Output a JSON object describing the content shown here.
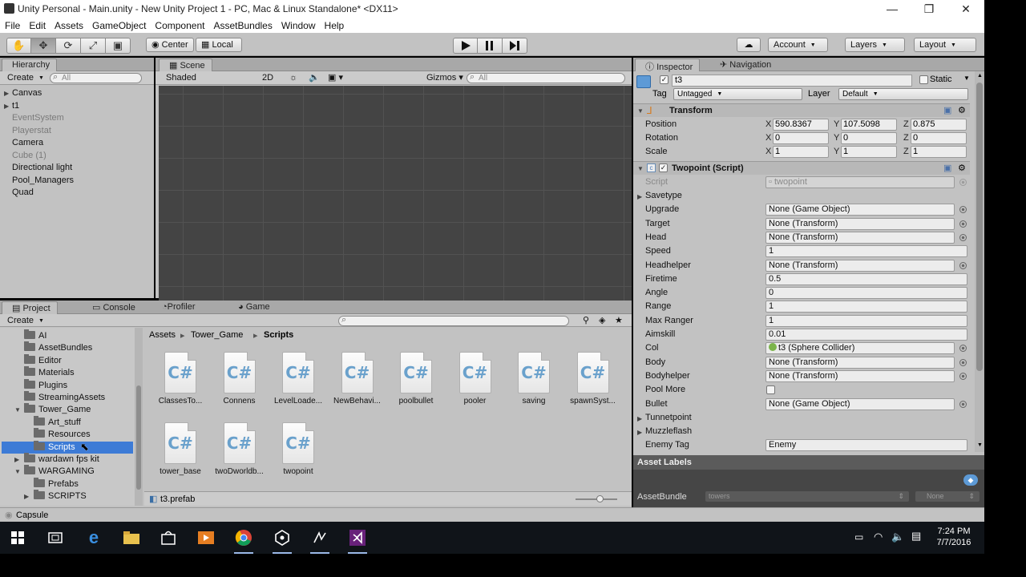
{
  "window": {
    "title": "Unity Personal - Main.unity - New Unity Project 1 - PC, Mac & Linux Standalone* <DX11>",
    "min": "—",
    "max": "❐",
    "close": "✕"
  },
  "menu": [
    "File",
    "Edit",
    "Assets",
    "GameObject",
    "Component",
    "AssetBundles",
    "Window",
    "Help"
  ],
  "toolbar": {
    "tools": [
      "✋",
      "✥",
      "⟳",
      "⤢",
      "▣"
    ],
    "pivot": "Center",
    "space": "Local",
    "cloud": "☁",
    "account": "Account",
    "layers": "Layers",
    "layout": "Layout"
  },
  "hierarchy": {
    "tab": "Hierarchy",
    "create": "Create",
    "search_placeholder": "All",
    "items": [
      {
        "label": "Canvas",
        "disabled": false,
        "arrow": true
      },
      {
        "label": "t1",
        "disabled": false,
        "arrow": true
      },
      {
        "label": "EventSystem",
        "disabled": true,
        "arrow": false
      },
      {
        "label": "Playerstat",
        "disabled": true,
        "arrow": false
      },
      {
        "label": "Camera",
        "disabled": false,
        "arrow": false
      },
      {
        "label": "Cube (1)",
        "disabled": true,
        "arrow": false
      },
      {
        "label": "Directional light",
        "disabled": false,
        "arrow": false
      },
      {
        "label": "Pool_Managers",
        "disabled": false,
        "arrow": false
      },
      {
        "label": "Quad",
        "disabled": false,
        "arrow": false
      }
    ]
  },
  "scene": {
    "tab": "Scene",
    "shading": "Shaded",
    "mode2d": "2D",
    "gizmos": "Gizmos",
    "search_placeholder": "All"
  },
  "project": {
    "tabs": [
      "Project",
      "Console",
      "Profiler",
      "Game"
    ],
    "create": "Create",
    "tree": [
      {
        "label": "AI",
        "indent": 1,
        "arrow": ""
      },
      {
        "label": "AssetBundles",
        "indent": 1,
        "arrow": ""
      },
      {
        "label": "Editor",
        "indent": 1,
        "arrow": ""
      },
      {
        "label": "Materials",
        "indent": 1,
        "arrow": ""
      },
      {
        "label": "Plugins",
        "indent": 1,
        "arrow": ""
      },
      {
        "label": "StreamingAssets",
        "indent": 1,
        "arrow": ""
      },
      {
        "label": "Tower_Game",
        "indent": 1,
        "arrow": "▼"
      },
      {
        "label": "Art_stuff",
        "indent": 2,
        "arrow": ""
      },
      {
        "label": "Resources",
        "indent": 2,
        "arrow": ""
      },
      {
        "label": "Scripts",
        "indent": 2,
        "arrow": "",
        "selected": true
      },
      {
        "label": "wardawn fps kit",
        "indent": 1,
        "arrow": "▶"
      },
      {
        "label": "WARGAMING",
        "indent": 1,
        "arrow": "▼"
      },
      {
        "label": "Prefabs",
        "indent": 2,
        "arrow": ""
      },
      {
        "label": "SCRIPTS",
        "indent": 2,
        "arrow": "▶"
      }
    ],
    "breadcrumb": [
      "Assets",
      "Tower_Game",
      "Scripts"
    ],
    "assets": [
      "ClassesTo...",
      "Connens",
      "LevelLoade...",
      "NewBehavi...",
      "poolbullet",
      "pooler",
      "saving",
      "spawnSyst...",
      "tower_base",
      "twoDworldb...",
      "twopoint"
    ],
    "asset_icon": "C#",
    "selected_file": "t3.prefab",
    "status": "Capsule"
  },
  "inspector": {
    "tabs": [
      "Inspector",
      "Navigation"
    ],
    "object_name": "t3",
    "static_label": "Static",
    "tag_label": "Tag",
    "tag_value": "Untagged",
    "layer_label": "Layer",
    "layer_value": "Default",
    "transform": {
      "title": "Transform",
      "rows": [
        {
          "label": "Position",
          "x": "590.8367",
          "y": "107.5098",
          "z": "0.875"
        },
        {
          "label": "Rotation",
          "x": "0",
          "y": "0",
          "z": "0"
        },
        {
          "label": "Scale",
          "x": "1",
          "y": "1",
          "z": "1"
        }
      ]
    },
    "script": {
      "title": "Twopoint (Script)",
      "script_label": "Script",
      "script_value": "twopoint",
      "fields": [
        {
          "label": "Savetype",
          "value": null,
          "type": "fold"
        },
        {
          "label": "Upgrade",
          "value": "None (Game Object)",
          "type": "obj"
        },
        {
          "label": "Target",
          "value": "None (Transform)",
          "type": "obj"
        },
        {
          "label": "Head",
          "value": "None (Transform)",
          "type": "obj"
        },
        {
          "label": "Speed",
          "value": "1",
          "type": "val"
        },
        {
          "label": "Headhelper",
          "value": "None (Transform)",
          "type": "obj"
        },
        {
          "label": "Firetime",
          "value": "0.5",
          "type": "val"
        },
        {
          "label": "Angle",
          "value": "0",
          "type": "val"
        },
        {
          "label": "Range",
          "value": "1",
          "type": "val"
        },
        {
          "label": "Max Ranger",
          "value": "1",
          "type": "val"
        },
        {
          "label": "Aimskill",
          "value": "0.01",
          "type": "val"
        },
        {
          "label": "Col",
          "value": "t3 (Sphere Collider)",
          "type": "obj"
        },
        {
          "label": "Body",
          "value": "None (Transform)",
          "type": "obj"
        },
        {
          "label": "Bodyhelper",
          "value": "None (Transform)",
          "type": "obj"
        },
        {
          "label": "Pool More",
          "value": null,
          "type": "check"
        },
        {
          "label": "Bullet",
          "value": "None (Game Object)",
          "type": "obj"
        },
        {
          "label": "Tunnetpoint",
          "value": null,
          "type": "fold"
        },
        {
          "label": "Muzzleflash",
          "value": null,
          "type": "fold"
        },
        {
          "label": "Enemy Tag",
          "value": "Enemy",
          "type": "val"
        }
      ]
    },
    "asset_labels": "Asset Labels",
    "assetbundle_label": "AssetBundle",
    "assetbundle_value": "towers",
    "assetbundle_variant": "None"
  },
  "taskbar": {
    "time": "7:24 PM",
    "date": "7/7/2016"
  },
  "colors": {
    "selection": "#3d7bd6",
    "panel": "#c2c2c2",
    "scene": "#444444"
  }
}
